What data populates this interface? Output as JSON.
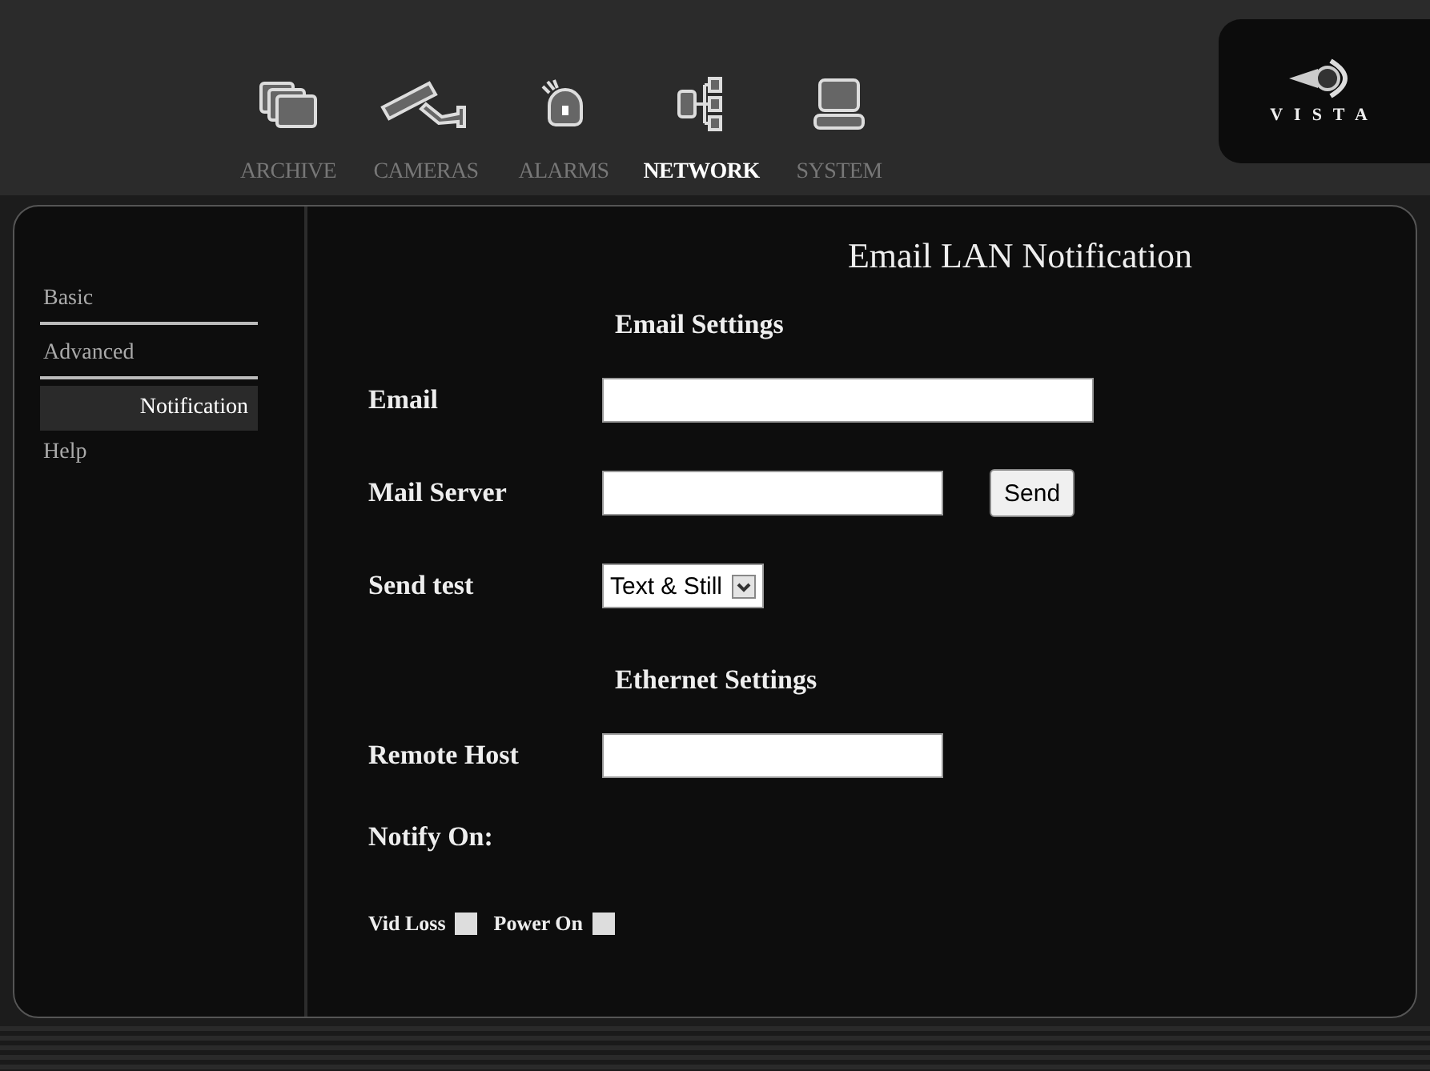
{
  "tabs": [
    {
      "label": "ARCHIVE",
      "selected": false
    },
    {
      "label": "CAMERAS",
      "selected": false
    },
    {
      "label": "ALARMS",
      "selected": false
    },
    {
      "label": "NETWORK",
      "selected": true
    },
    {
      "label": "SYSTEM",
      "selected": false
    }
  ],
  "logo": {
    "text": "VISTA"
  },
  "sidebar": {
    "items": [
      {
        "label": "Basic",
        "selected": false
      },
      {
        "label": "Advanced",
        "selected": false
      },
      {
        "label": "Notification",
        "selected": true
      },
      {
        "label": "Help",
        "selected": false
      }
    ]
  },
  "page_title": "Email LAN Notification",
  "sections": [
    {
      "heading": "Email Settings",
      "fields": [
        {
          "kind": "wide_text",
          "label": "Email"
        },
        {
          "kind": "text_button",
          "label": "Mail Server",
          "button": "Send"
        },
        {
          "kind": "select",
          "label": "Send test",
          "value": "Text & Still"
        }
      ]
    },
    {
      "heading": "Ethernet Settings",
      "fields": [
        {
          "kind": "text",
          "label": "Remote Host"
        }
      ]
    }
  ],
  "notify": {
    "label": "Notify On:",
    "options": [
      {
        "label": "Vid Loss",
        "checked": false
      },
      {
        "label": "Power On",
        "checked": false
      }
    ]
  }
}
